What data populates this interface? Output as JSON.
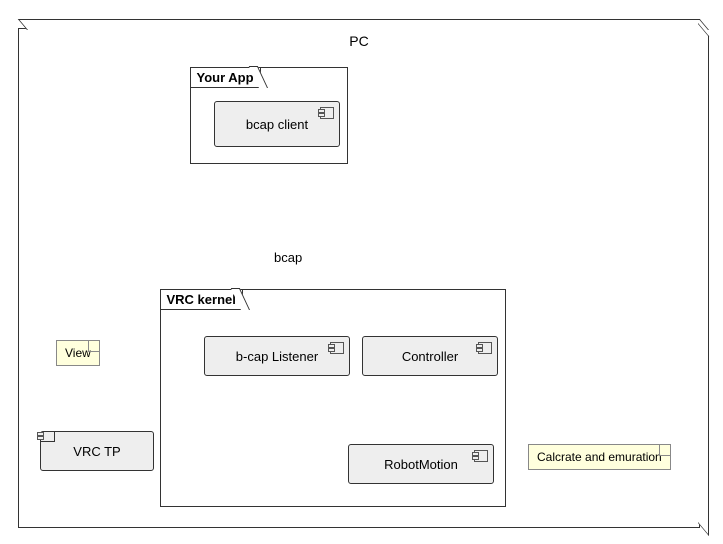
{
  "node": {
    "title": "PC"
  },
  "packages": {
    "yourApp": {
      "label": "Your App"
    },
    "vrcKernel": {
      "label": "VRC kernel"
    }
  },
  "components": {
    "bcapClient": {
      "label": "bcap client"
    },
    "bcapListener": {
      "label": "b-cap Listener"
    },
    "controller": {
      "label": "Controller"
    },
    "robotMotion": {
      "label": "RobotMotion"
    },
    "vrcTp": {
      "label": "VRC TP"
    }
  },
  "notes": {
    "view": {
      "text": "View"
    },
    "calc": {
      "text": "Calcrate and emuration"
    }
  },
  "labels": {
    "bcap": "bcap"
  }
}
